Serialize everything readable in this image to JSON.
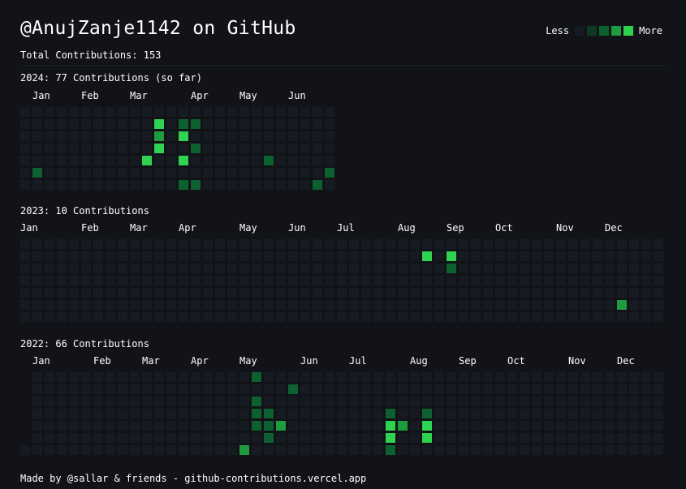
{
  "header": {
    "title": "@AnujZanje1142 on GitHub",
    "total": "Total Contributions: 153"
  },
  "legend": {
    "less": "Less",
    "more": "More",
    "levels": [
      "#161b22",
      "#0e3a24",
      "#0d6130",
      "#1f9c3f",
      "#2fd352"
    ]
  },
  "colors": {
    "background": "#111318",
    "empty_cell": "#161b22"
  },
  "years": [
    {
      "title": "2024: 77 Contributions (so far)",
      "months": [
        {
          "label": "Jan",
          "week": 1
        },
        {
          "label": "Feb",
          "week": 5
        },
        {
          "label": "Mar",
          "week": 9
        },
        {
          "label": "Apr",
          "week": 14
        },
        {
          "label": "May",
          "week": 18
        },
        {
          "label": "Jun",
          "week": 22
        }
      ],
      "weeks": 26,
      "first_day": 0,
      "last_week_days": 7,
      "contributions": [
        {
          "week": 1,
          "day": 5,
          "level": 2
        },
        {
          "week": 10,
          "day": 4,
          "level": 4
        },
        {
          "week": 11,
          "day": 1,
          "level": 4
        },
        {
          "week": 11,
          "day": 2,
          "level": 3
        },
        {
          "week": 11,
          "day": 3,
          "level": 4
        },
        {
          "week": 13,
          "day": 1,
          "level": 2
        },
        {
          "week": 13,
          "day": 2,
          "level": 4
        },
        {
          "week": 13,
          "day": 4,
          "level": 4
        },
        {
          "week": 13,
          "day": 6,
          "level": 2
        },
        {
          "week": 14,
          "day": 1,
          "level": 2
        },
        {
          "week": 14,
          "day": 3,
          "level": 2
        },
        {
          "week": 14,
          "day": 6,
          "level": 2
        },
        {
          "week": 20,
          "day": 4,
          "level": 2
        },
        {
          "week": 24,
          "day": 6,
          "level": 2
        },
        {
          "week": 25,
          "day": 5,
          "level": 2
        }
      ]
    },
    {
      "title": "2023: 10 Contributions",
      "months": [
        {
          "label": "Jan",
          "week": 0
        },
        {
          "label": "Feb",
          "week": 5
        },
        {
          "label": "Mar",
          "week": 9
        },
        {
          "label": "Apr",
          "week": 13
        },
        {
          "label": "May",
          "week": 18
        },
        {
          "label": "Jun",
          "week": 22
        },
        {
          "label": "Jul",
          "week": 26
        },
        {
          "label": "Aug",
          "week": 31
        },
        {
          "label": "Sep",
          "week": 35
        },
        {
          "label": "Oct",
          "week": 39
        },
        {
          "label": "Nov",
          "week": 44
        },
        {
          "label": "Dec",
          "week": 48
        }
      ],
      "weeks": 53,
      "first_day": 0,
      "last_week_days": 7,
      "contributions": [
        {
          "week": 33,
          "day": 1,
          "level": 4
        },
        {
          "week": 35,
          "day": 1,
          "level": 4
        },
        {
          "week": 35,
          "day": 2,
          "level": 2
        },
        {
          "week": 49,
          "day": 5,
          "level": 3
        }
      ]
    },
    {
      "title": "2022: 66 Contributions",
      "months": [
        {
          "label": "Jan",
          "week": 1
        },
        {
          "label": "Feb",
          "week": 6
        },
        {
          "label": "Mar",
          "week": 10
        },
        {
          "label": "Apr",
          "week": 14
        },
        {
          "label": "May",
          "week": 18
        },
        {
          "label": "Jun",
          "week": 23
        },
        {
          "label": "Jul",
          "week": 27
        },
        {
          "label": "Aug",
          "week": 32
        },
        {
          "label": "Sep",
          "week": 36
        },
        {
          "label": "Oct",
          "week": 40
        },
        {
          "label": "Nov",
          "week": 45
        },
        {
          "label": "Dec",
          "week": 49
        }
      ],
      "weeks": 53,
      "first_day": 6,
      "last_week_days": 7,
      "contributions": [
        {
          "week": 19,
          "day": 0,
          "level": 2
        },
        {
          "week": 19,
          "day": 2,
          "level": 2
        },
        {
          "week": 19,
          "day": 3,
          "level": 2
        },
        {
          "week": 19,
          "day": 4,
          "level": 2
        },
        {
          "week": 20,
          "day": 3,
          "level": 2
        },
        {
          "week": 20,
          "day": 4,
          "level": 2
        },
        {
          "week": 20,
          "day": 5,
          "level": 2
        },
        {
          "week": 21,
          "day": 4,
          "level": 3
        },
        {
          "week": 22,
          "day": 1,
          "level": 2
        },
        {
          "week": 18,
          "day": 6,
          "level": 3
        },
        {
          "week": 30,
          "day": 3,
          "level": 2
        },
        {
          "week": 30,
          "day": 4,
          "level": 4
        },
        {
          "week": 30,
          "day": 5,
          "level": 4
        },
        {
          "week": 30,
          "day": 6,
          "level": 2
        },
        {
          "week": 31,
          "day": 4,
          "level": 3
        },
        {
          "week": 33,
          "day": 3,
          "level": 2
        },
        {
          "week": 33,
          "day": 4,
          "level": 4
        },
        {
          "week": 33,
          "day": 5,
          "level": 4
        }
      ]
    }
  ],
  "footer": {
    "text": "Made by @sallar & friends - github-contributions.vercel.app"
  }
}
